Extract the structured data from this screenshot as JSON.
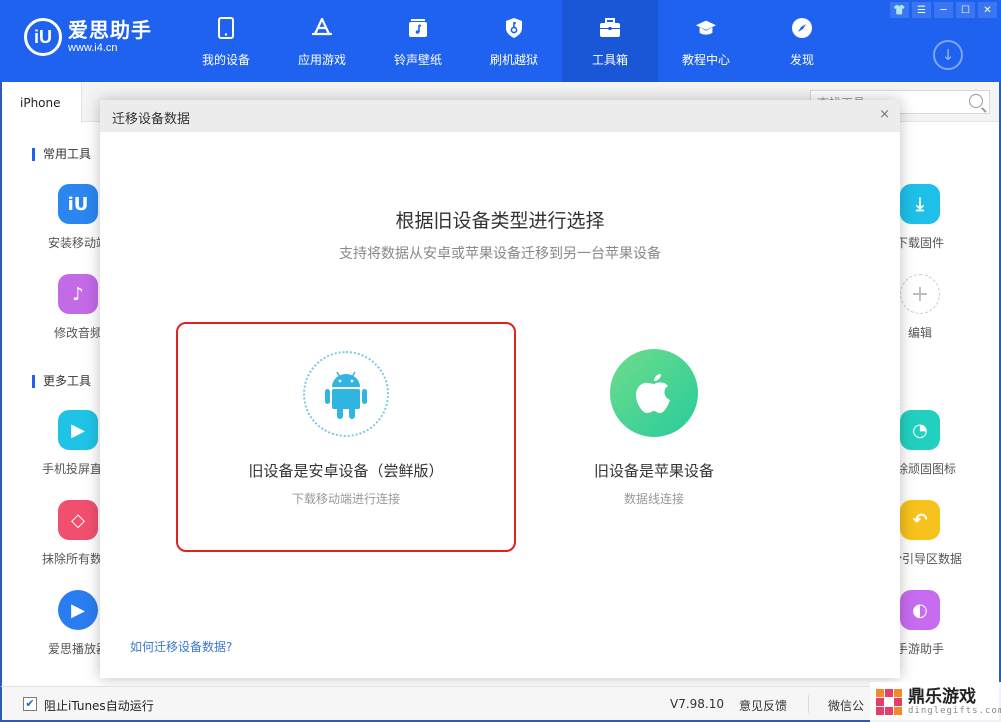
{
  "app": {
    "logo_name": "爱思助手",
    "logo_url": "www.i4.cn",
    "logo_glyph": "iU"
  },
  "nav": [
    {
      "label": "我的设备",
      "icon": "phone-icon",
      "active": false
    },
    {
      "label": "应用游戏",
      "icon": "app-store-icon",
      "active": false
    },
    {
      "label": "铃声壁纸",
      "icon": "music-note-icon",
      "active": false
    },
    {
      "label": "刷机越狱",
      "icon": "key-shield-icon",
      "active": false
    },
    {
      "label": "工具箱",
      "icon": "toolbox-icon",
      "active": true
    },
    {
      "label": "教程中心",
      "icon": "graduation-cap-icon",
      "active": false
    },
    {
      "label": "发现",
      "icon": "compass-icon",
      "active": false
    }
  ],
  "window_controls": {
    "skin": "👕",
    "menu": "☰",
    "minimize": "─",
    "maximize": "☐",
    "close": "✕",
    "download": "↓"
  },
  "tabs": {
    "device_tab": "iPhone"
  },
  "search": {
    "placeholder": "查找工具"
  },
  "sections": {
    "common": "常用工具",
    "more": "更多工具"
  },
  "tools_left": [
    {
      "label": "安装移动端",
      "color": "#2b86f0",
      "glyph": "iU"
    },
    {
      "label": "修改音频",
      "color": "#c36ae6",
      "glyph": "♪"
    },
    {
      "label": "手机投屏直播",
      "color": "#1fc3e6",
      "glyph": "▶"
    },
    {
      "label": "抹除所有数据",
      "color": "#f0506e",
      "glyph": "◇"
    },
    {
      "label": "爱思播放器",
      "color": "#2a7df0",
      "glyph": "▶"
    }
  ],
  "tools_right": [
    {
      "label": "下载固件",
      "color": "#1ec0ea",
      "glyph": "⤓"
    },
    {
      "label": "编辑",
      "color": "#ffffff",
      "glyph": "+"
    },
    {
      "label": "删除顽固图标",
      "color": "#22d0c0",
      "glyph": "◔"
    },
    {
      "label": "备份引导区数据",
      "color": "#f7c21d",
      "glyph": "↶"
    },
    {
      "label": "手游助手",
      "color": "#c76cf0",
      "glyph": "◐"
    }
  ],
  "dialog": {
    "header": "迁移设备数据",
    "close": "×",
    "title": "根据旧设备类型进行选择",
    "subtitle": "支持将数据从安卓或苹果设备迁移到另一台苹果设备",
    "options": [
      {
        "title": "旧设备是安卓设备（尝鲜版）",
        "subtitle": "下载移动端进行连接",
        "selected": true
      },
      {
        "title": "旧设备是苹果设备",
        "subtitle": "数据线连接",
        "selected": false
      }
    ],
    "help_link": "如何迁移设备数据?"
  },
  "statusbar": {
    "checkbox_label": "阻止iTunes自动运行",
    "checkbox_checked": true,
    "check_glyph": "✔",
    "version": "V7.98.10",
    "feedback": "意见反馈",
    "wechat": "微信公"
  },
  "watermark": {
    "name": "鼎乐游戏",
    "url": "dinglegifts.com"
  },
  "colors": {
    "brand": "#1f62f0",
    "selected_border": "#e0231e",
    "link": "#3c78c8"
  }
}
